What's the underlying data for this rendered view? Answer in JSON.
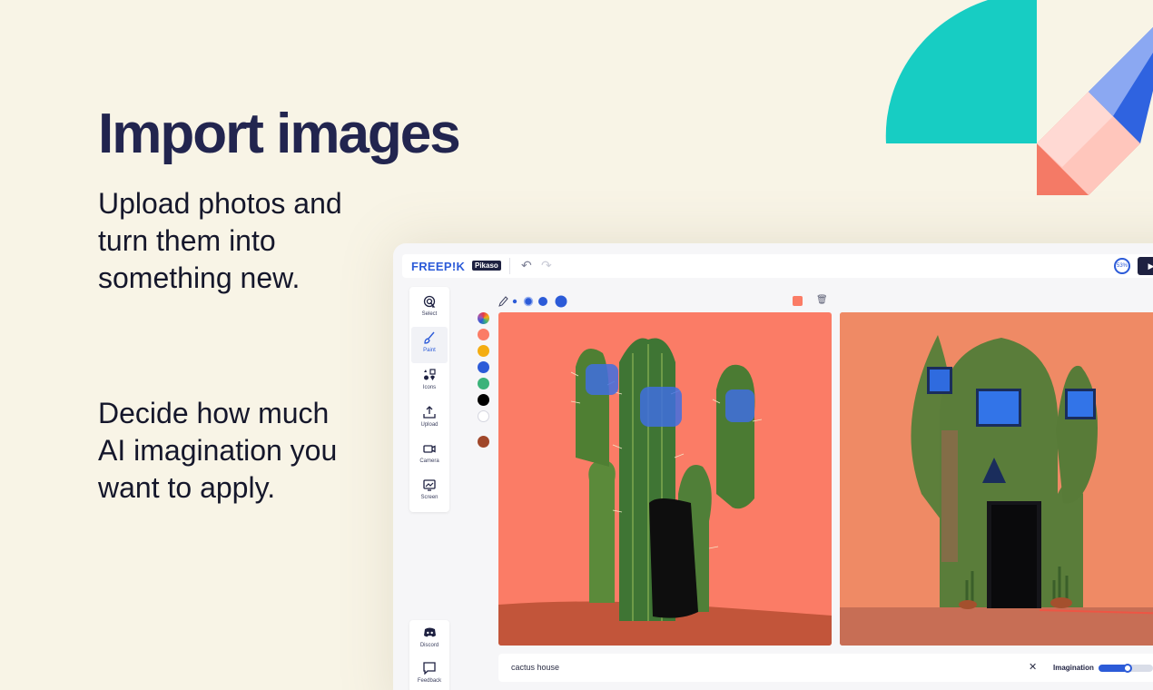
{
  "hero": {
    "title": "Import images",
    "paragraph1": "Upload photos and turn them into something new.",
    "paragraph2": "Decide how much AI imagination you want to apply."
  },
  "app": {
    "logo": "FREEP!K",
    "badge": "Pikaso",
    "undo_icon": "↶",
    "redo_icon": "↷",
    "credits": "53%",
    "play_icon": "▶",
    "tools": [
      {
        "label": "Select",
        "icon": "select-icon"
      },
      {
        "label": "Paint",
        "icon": "brush-icon"
      },
      {
        "label": "Icons",
        "icon": "shapes-icon"
      },
      {
        "label": "Upload",
        "icon": "upload-icon"
      },
      {
        "label": "Camera",
        "icon": "camera-icon"
      },
      {
        "label": "Screen",
        "icon": "screen-icon"
      }
    ],
    "bottom_tools": [
      {
        "label": "Discord",
        "icon": "discord-icon"
      },
      {
        "label": "Feedback",
        "icon": "feedback-icon"
      }
    ],
    "palette": [
      "rainbow",
      "#fb7c66",
      "#f4ad12",
      "#2c5bd8",
      "#3bb37a",
      "#000000",
      "#ffffff",
      "#a0472a"
    ],
    "current_color": "#fb7c66",
    "trash_icon": "🗑",
    "prompt": {
      "text": "cactus house",
      "clear_icon": "✕",
      "imagination_label": "Imagination",
      "imagination_level": 0.53
    }
  },
  "colors": {
    "background": "#f8f4e6",
    "accent": "#2c5bd8",
    "teal": "#17cdc3",
    "coral": "#fb7c66"
  }
}
